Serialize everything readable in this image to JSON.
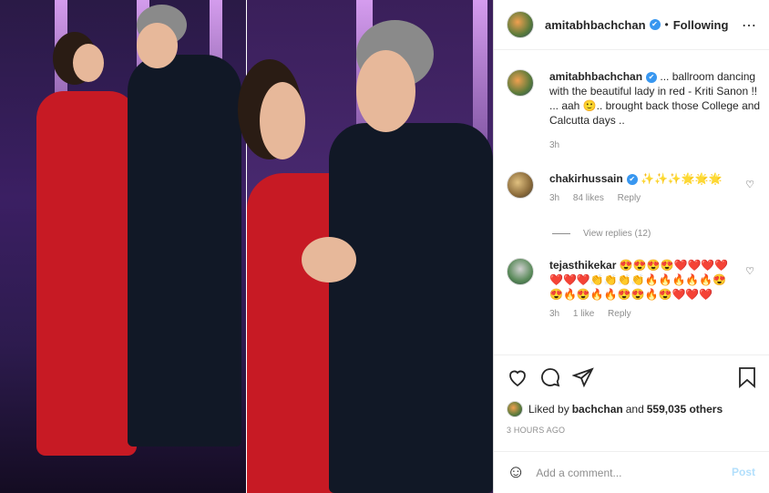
{
  "header": {
    "username": "amitabhbachchan",
    "verified_mark": "✔",
    "separator": "•",
    "follow_status": "Following",
    "more_glyph": "⋯"
  },
  "caption": {
    "username": "amitabhbachchan",
    "text": "... ballroom dancing with the beautiful lady in red - Kriti Sanon !! ... aah 🙂.. brought back those College and Calcutta days ..",
    "time": "3h"
  },
  "comments": [
    {
      "username": "chakirhussain",
      "text": "✨✨✨🌟🌟🌟",
      "time": "3h",
      "likes": "84 likes",
      "reply": "Reply"
    },
    {
      "username": "tejasthikekar",
      "text": "😍😍😍😍❤️❤️❤️❤️❤️❤️❤️👏👏👏👏🔥🔥🔥🔥🔥😍😍🔥😍🔥🔥😍😍🔥😍❤️❤️❤️",
      "time": "3h",
      "likes": "1 like",
      "reply": "Reply"
    }
  ],
  "view_replies": "View replies (12)",
  "actions": {
    "like_icon": "heart-outline",
    "comment_icon": "comment-bubble",
    "share_icon": "paper-plane",
    "save_icon": "bookmark"
  },
  "likes": {
    "prefix": "Liked by",
    "user": "bachchan",
    "middle": "and",
    "count": "559,035 others"
  },
  "timestamp": "3 HOURS AGO",
  "add_comment": {
    "placeholder": "Add a comment...",
    "post_label": "Post",
    "emoji_glyph": "☺"
  }
}
